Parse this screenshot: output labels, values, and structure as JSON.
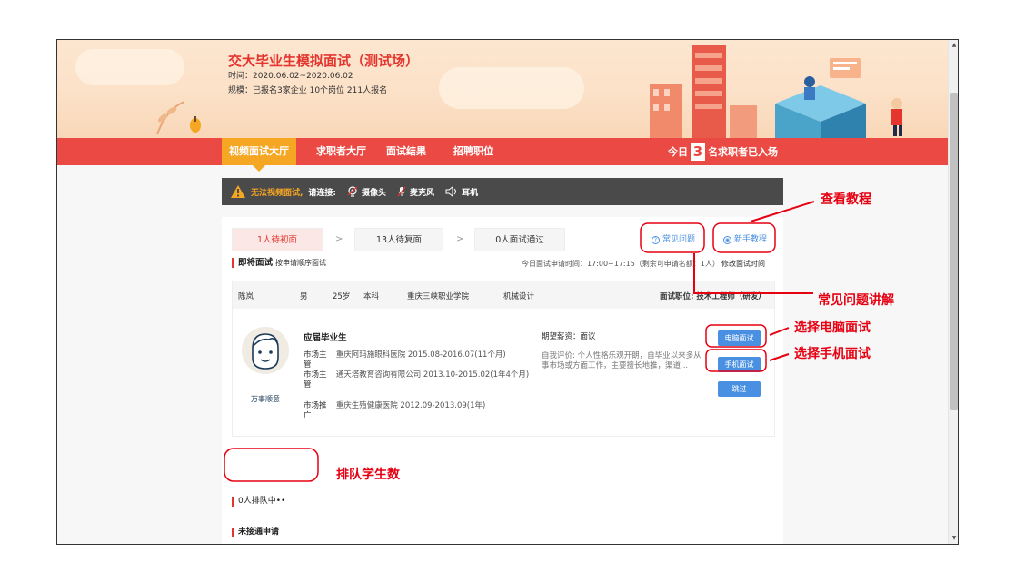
{
  "banner": {
    "title": "交大毕业生模拟面试（测试场）",
    "time": "时间：2020.06.02~2020.06.02",
    "scale": "规模：已报名3家企业 10个岗位 211人报名"
  },
  "nav": {
    "tabs": [
      "视频面试大厅",
      "求职者大厅",
      "面试结果",
      "招聘职位"
    ],
    "today_prefix": "今日",
    "today_count": "3",
    "today_suffix": "名求职者已入场"
  },
  "warning": {
    "text": "无法视频面试,",
    "sub": "请连接:",
    "camera": "摄像头",
    "mic": "麦克风",
    "earphone": "耳机"
  },
  "steps": {
    "first": "1人待初面",
    "second": "13人待复面",
    "passed": "0人面试通过",
    "arrow": ">"
  },
  "help": {
    "faq": "常见问题",
    "guide": "新手教程"
  },
  "interview": {
    "title": "即将面试",
    "subtitle": "按申请顺序面试",
    "apply_time": "今日面试申请时间：17:00~17:15（剩余可申请名额：1人）",
    "modify_time": "修改面试时间"
  },
  "candidate": {
    "name": "陈岚",
    "gender": "男",
    "age": "25岁",
    "degree": "本科",
    "school": "重庆三峡职业学院",
    "major": "机械设计",
    "position": "面试职位: 技术工程师（研发）",
    "type": "应届毕业生",
    "avatar_caption": "万事顺意",
    "experiences": [
      {
        "role": "市场主管",
        "detail": "重庆阿玛施眼科医院 2015.08-2016.07(11个月)"
      },
      {
        "role": "市场主管",
        "detail": "通天塔教育咨询有限公司 2013.10-2015.02(1年4个月)"
      },
      {
        "role": "市场推广",
        "detail": "重庆生殖健康医院 2012.09-2013.09(1年)"
      }
    ],
    "salary": "期望薪资：面议",
    "self_eval": "自我评价: 个人性格乐观开朗，自毕业以来多从事市场或方面工作，主要擅长地推，渠道...",
    "btn_pc": "电脑面试",
    "btn_mobile": "手机面试",
    "btn_skip": "跳过"
  },
  "queue": {
    "label": "0人排队中••",
    "unconnected": "未接通申请"
  },
  "annotations": {
    "view_tutorial": "查看教程",
    "faq_explain": "常见问题讲解",
    "choose_pc": "选择电脑面试",
    "choose_mobile": "选择手机面试",
    "queue_count": "排队学生数"
  },
  "colors": {
    "brand_red": "#ea4a43",
    "active_tab": "#f5a623",
    "button_blue": "#4a90e2",
    "annotation_red": "#e60012"
  }
}
